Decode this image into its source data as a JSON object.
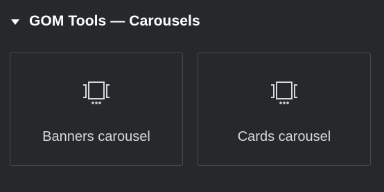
{
  "section": {
    "title": "GOM Tools — Carousels",
    "expanded_icon": "caret-down-icon"
  },
  "widgets": [
    {
      "label": "Banners carousel",
      "icon": "carousel-icon"
    },
    {
      "label": "Cards carousel",
      "icon": "carousel-icon"
    }
  ],
  "colors": {
    "background": "#26292c",
    "card_border": "#474b4f",
    "title_text": "#ffffff",
    "label_text": "#d5d8dc"
  }
}
